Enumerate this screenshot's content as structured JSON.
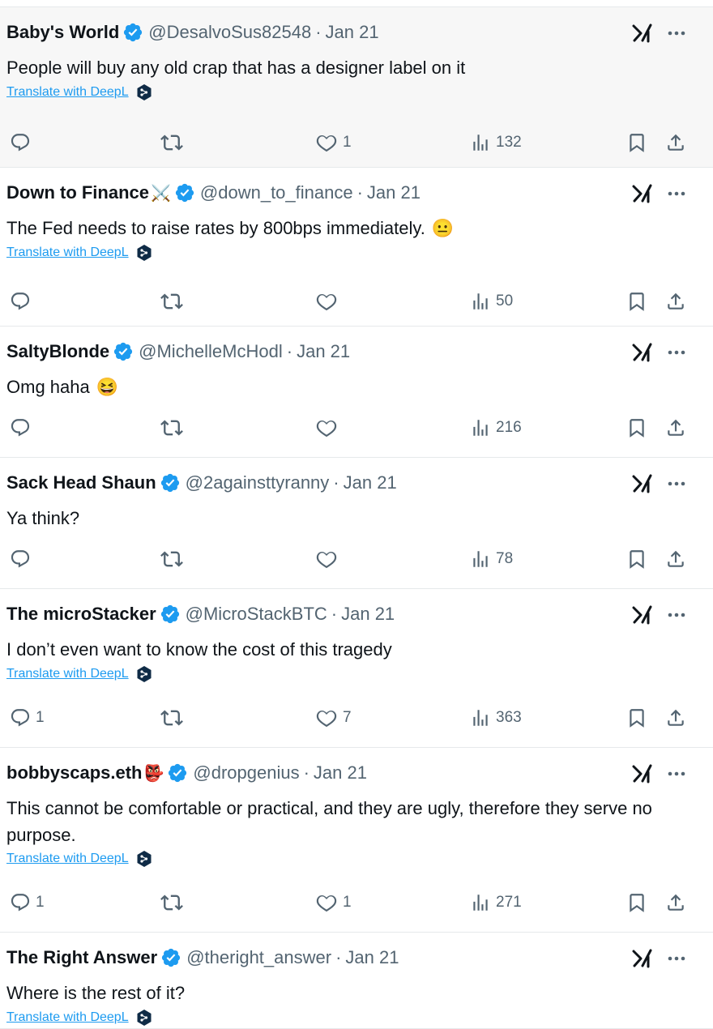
{
  "translate_label": "Translate with DeepL",
  "colors": {
    "accent": "#1d9bf0",
    "text": "#0f1419",
    "muted": "#536471",
    "highlight_bg": "#f7f7f7"
  },
  "icons": {
    "verified": "verified-badge-icon",
    "xai": "grok-icon",
    "more": "more-icon",
    "reply": "reply-icon",
    "repost": "repost-icon",
    "like": "like-icon",
    "views": "views-icon",
    "bookmark": "bookmark-icon",
    "share": "share-icon",
    "deepl": "deepl-logo-icon"
  },
  "tweets": [
    {
      "name": "Baby's World",
      "name_emoji": "",
      "handle": "@DesalvoSus82548",
      "date": "Jan 21",
      "text": "People will buy any old crap that has a designer label on it",
      "emoji": "",
      "translate": true,
      "replies": "",
      "reposts": "",
      "likes": "1",
      "views": "132"
    },
    {
      "name": "Down to Finance",
      "name_emoji": "⚔️",
      "handle": "@down_to_finance",
      "date": "Jan 21",
      "text": "The Fed needs to raise rates by 800bps immediately.",
      "emoji": "😐",
      "translate": true,
      "replies": "",
      "reposts": "",
      "likes": "",
      "views": "50"
    },
    {
      "name": "SaltyBlonde",
      "name_emoji": "",
      "handle": "@MichelleMcHodl",
      "date": "Jan 21",
      "text": "Omg haha",
      "emoji": "😆",
      "translate": false,
      "replies": "",
      "reposts": "",
      "likes": "",
      "views": "216"
    },
    {
      "name": "Sack Head Shaun",
      "name_emoji": "",
      "handle": "@2againsttyranny",
      "date": "Jan 21",
      "text": "Ya think?",
      "emoji": "",
      "translate": false,
      "replies": "",
      "reposts": "",
      "likes": "",
      "views": "78"
    },
    {
      "name": "The microStacker",
      "name_emoji": "",
      "handle": "@MicroStackBTC",
      "date": "Jan 21",
      "text": "I don’t even want to know the cost of this tragedy",
      "emoji": "",
      "translate": true,
      "replies": "1",
      "reposts": "",
      "likes": "7",
      "views": "363"
    },
    {
      "name": "bobbyscaps.eth",
      "name_emoji": "👺",
      "handle": "@dropgenius",
      "date": "Jan 21",
      "text": "This cannot be comfortable or practical, and they are ugly, therefore they serve no purpose.",
      "emoji": "",
      "translate": true,
      "replies": "1",
      "reposts": "",
      "likes": "1",
      "views": "271"
    },
    {
      "name": "The Right Answer",
      "name_emoji": "",
      "handle": "@theright_answer",
      "date": "Jan 21",
      "text": "Where is the rest of it?",
      "emoji": "",
      "translate": true,
      "replies": "",
      "reposts": "",
      "likes": "",
      "views": ""
    }
  ]
}
